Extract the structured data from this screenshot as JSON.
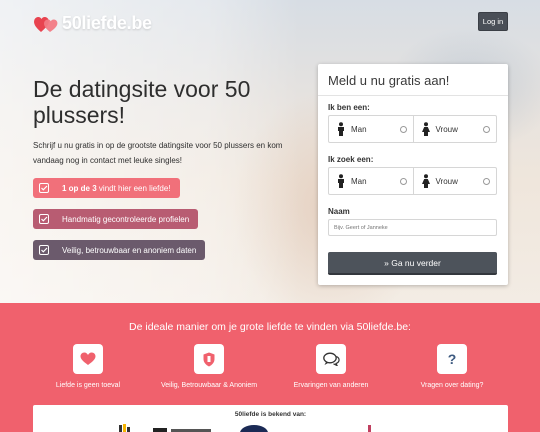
{
  "header": {
    "logo_text": "50liefde.be",
    "login_label": "Log in"
  },
  "hero": {
    "title": "De datingsite voor 50 plussers!",
    "subtitle": "Schrijf u nu gratis in op de grootste datingsite voor 50 plussers en kom vandaag nog in contact met leuke singles!",
    "features": [
      {
        "bold": "1 op de 3",
        "text": " vindt hier een liefde!"
      },
      {
        "text": "Handmatig gecontroleerde profielen"
      },
      {
        "text": "Veilig, betrouwbaar en anoniem daten"
      }
    ]
  },
  "form": {
    "title": "Meld u nu gratis aan!",
    "i_am_label": "Ik ben een:",
    "seeking_label": "Ik zoek een:",
    "man_label": "Man",
    "woman_label": "Vrouw",
    "name_label": "Naam",
    "name_placeholder": "Bijv. Geert of Janneke",
    "submit_label": "» Ga nu verder"
  },
  "benefits": {
    "title": "De ideale manier om je grote liefde te vinden via 50liefde.be:",
    "items": [
      {
        "label": "Liefde is geen toeval",
        "icon": "heart-icon"
      },
      {
        "label": "Veilig, Betrouwbaar & Anoniem",
        "icon": "shield-icon"
      },
      {
        "label": "Ervaringen van anderen",
        "icon": "chat-bubbles-icon"
      },
      {
        "label": "Vragen over dating?",
        "icon": "question-icon"
      }
    ]
  },
  "known_from": {
    "title": "50liefde is bekend van:"
  },
  "colors": {
    "brand_red": "#f0616d",
    "button_dark": "#4d535b",
    "feature_1": "#f1707a",
    "feature_2": "#b85c72",
    "feature_3": "#6b5a6c"
  }
}
